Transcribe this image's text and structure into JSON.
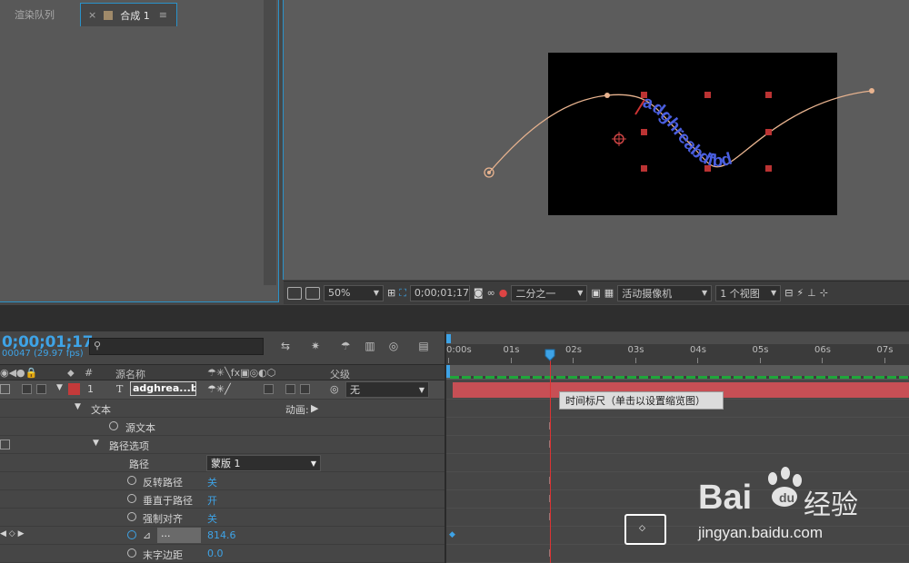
{
  "viewer": {
    "canvas_text": "adghreabdfbd",
    "zoom": "50%",
    "timecode": "0;00;01;17",
    "resolution": "二分之一",
    "camera": "活动摄像机",
    "views": "1 个视图"
  },
  "tabs": {
    "render_queue": "渲染队列",
    "composition": "合成 1",
    "close": "×",
    "menu": "≡"
  },
  "timeline": {
    "timecode": "0;00;01;17",
    "frames": "00047 (29.97 fps)",
    "search_placeholder": ""
  },
  "columns": {
    "number": "#",
    "source_name": "源名称",
    "parent": "父级"
  },
  "layer": {
    "index": "1",
    "type_glyph": "T",
    "name": "adghrea...bd",
    "parent_value": "无"
  },
  "props": {
    "text": "文本",
    "animate": "动画:",
    "source_text": "源文本",
    "path_options": "路径选项",
    "path": "路径",
    "path_value": "蒙版 1",
    "reverse_path": "反转路径",
    "reverse_path_value": "关",
    "perpendicular": "垂直于路径",
    "perpendicular_value": "开",
    "force_align": "强制对齐",
    "force_align_value": "关",
    "first_margin_label": "...",
    "first_margin_value": "814.6",
    "last_margin": "末字边距",
    "last_margin_value": "0.0"
  },
  "ruler": {
    "ticks": [
      "0:00s",
      "01s",
      "02s",
      "03s",
      "04s",
      "05s",
      "06s",
      "07s"
    ]
  },
  "tooltip": "时间标尺（单击以设置缩览图）",
  "watermark": {
    "brand": "Bai",
    "brand2": "经验",
    "url": "jingyan.baidu.com"
  },
  "colors": {
    "accent": "#3ea3e6",
    "layer_label": "#c74f55",
    "playhead": "#dd3333"
  }
}
